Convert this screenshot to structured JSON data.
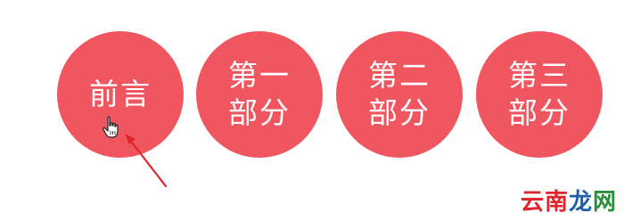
{
  "nav": {
    "items": [
      {
        "lines": [
          "前言"
        ]
      },
      {
        "lines": [
          "第一",
          "部分"
        ]
      },
      {
        "lines": [
          "第二",
          "部分"
        ]
      },
      {
        "lines": [
          "第三",
          "部分"
        ]
      }
    ]
  },
  "colors": {
    "circle": "#f0565f",
    "arrow": "#e0242c",
    "text": "#ffffff"
  },
  "watermark": {
    "part1": "云南",
    "part2": "龙",
    "part3": "网"
  }
}
